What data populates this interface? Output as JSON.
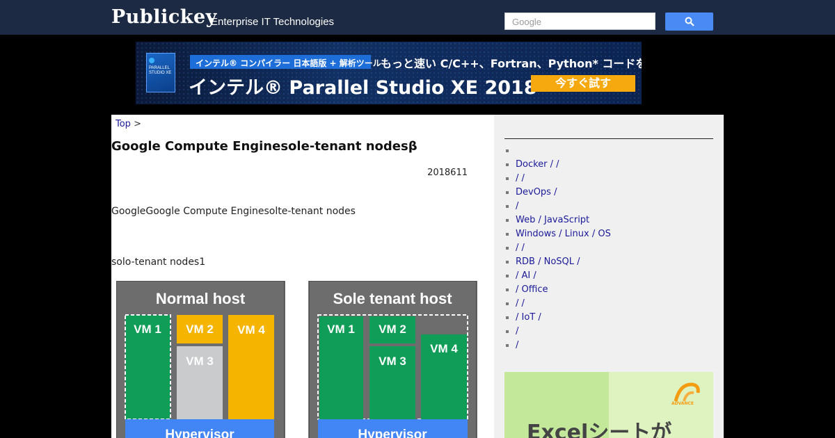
{
  "header": {
    "logo": "Publickey",
    "tagline": "Enterprise IT Technologies",
    "search_placeholder": "Google"
  },
  "banner": {
    "pill": "インテル® コンパイラー 日本語版 + 解析ツール",
    "subtitle": "もっと速い C/C++、Fortran、Python* コードを開発",
    "title": "インテル® Parallel Studio XE 2018",
    "cta": "今すぐ試す",
    "box_text": "PARALLEL STUDIO XE"
  },
  "article": {
    "breadcrumb_top": "Top",
    "breadcrumb_sep": ">",
    "title": "Google Compute Enginesole-tenant nodesβ",
    "date": "2018611",
    "para1": "GoogleGoogle Compute Enginesolte-tenant nodes",
    "para2": "solo-tenant nodes1"
  },
  "diagram": {
    "left_title": "Normal host",
    "right_title": "Sole tenant host",
    "vm1": "VM 1",
    "vm2": "VM 2",
    "vm3": "VM 3",
    "vm4": "VM 4",
    "hypervisor": "Hypervisor",
    "colors": {
      "gray": "#6d6d6d",
      "green": "#0f9d58",
      "yellow": "#f4b400",
      "silver": "#c9cbcc",
      "blue": "#4285f4"
    }
  },
  "sidebar": {
    "items": [
      {
        "label": ""
      },
      {
        "label": "Docker /  /"
      },
      {
        "label": " /  /"
      },
      {
        "label": "DevOps /"
      },
      {
        "label": " /"
      },
      {
        "label": "Web / JavaScript"
      },
      {
        "label": "Windows / Linux / OS"
      },
      {
        "label": "        /  /"
      },
      {
        "label": "RDB / NoSQL /"
      },
      {
        "label": " / AI /"
      },
      {
        "label": " / Office"
      },
      {
        "label": " /  /"
      },
      {
        "label": " / IoT /"
      },
      {
        "label": " /"
      },
      {
        "label": " /"
      }
    ],
    "ad_text": "Excelシートが",
    "ad_logo_text": "ADVANCE"
  }
}
